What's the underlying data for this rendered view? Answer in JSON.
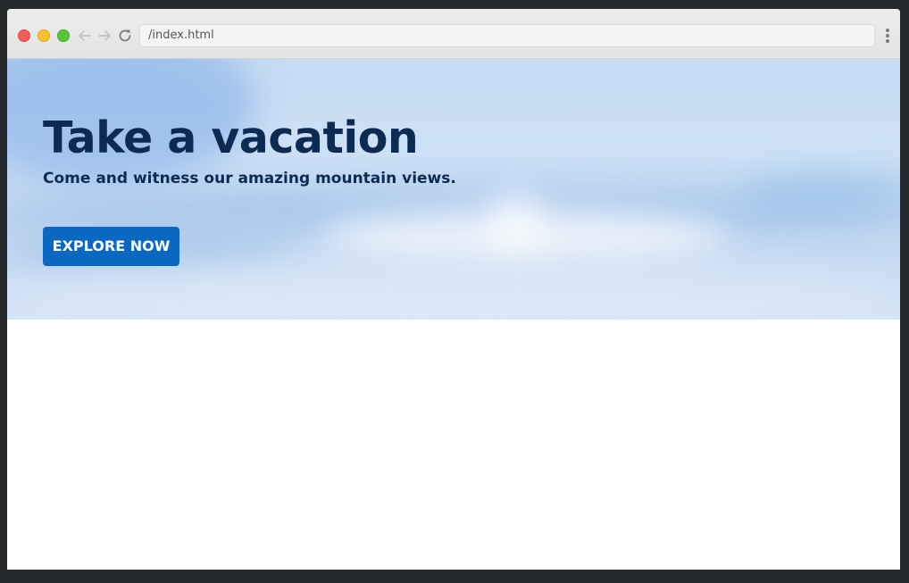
{
  "browser": {
    "url": "/index.html"
  },
  "hero": {
    "title": "Take a vacation",
    "subtitle": "Come and witness our amazing mountain views.",
    "cta_label": "EXPLORE NOW"
  },
  "colors": {
    "title_text": "#0c2b52",
    "button_background": "#0b68c2",
    "button_text": "#ffffff",
    "traffic_red": "#f25f58",
    "traffic_yellow": "#f9be2e",
    "traffic_green": "#57c638"
  },
  "icons": {
    "back": "arrow-left-icon",
    "forward": "arrow-right-icon",
    "reload": "reload-icon",
    "menu": "kebab-menu-icon"
  }
}
